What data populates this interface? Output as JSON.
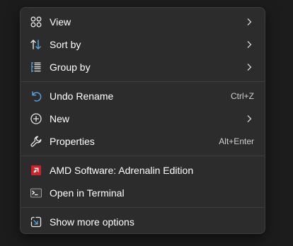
{
  "menu": {
    "items": [
      {
        "label": "View",
        "icon": "grid-icon",
        "submenu": true
      },
      {
        "label": "Sort by",
        "icon": "sort-icon",
        "submenu": true
      },
      {
        "label": "Group by",
        "icon": "group-list-icon",
        "submenu": true
      },
      {
        "label": "Undo Rename",
        "icon": "undo-icon",
        "shortcut": "Ctrl+Z"
      },
      {
        "label": "New",
        "icon": "plus-circle-icon",
        "submenu": true
      },
      {
        "label": "Properties",
        "icon": "wrench-icon",
        "shortcut": "Alt+Enter"
      },
      {
        "label": "AMD Software: Adrenalin Edition",
        "icon": "amd-logo-icon"
      },
      {
        "label": "Open in Terminal",
        "icon": "terminal-icon"
      },
      {
        "label": "Show more options",
        "icon": "share-window-icon"
      }
    ]
  },
  "colors": {
    "menu_background": "#2c2c2c",
    "accent_blue": "#5aa7e0",
    "amd_red": "#d1202a",
    "text": "#ffffff"
  }
}
